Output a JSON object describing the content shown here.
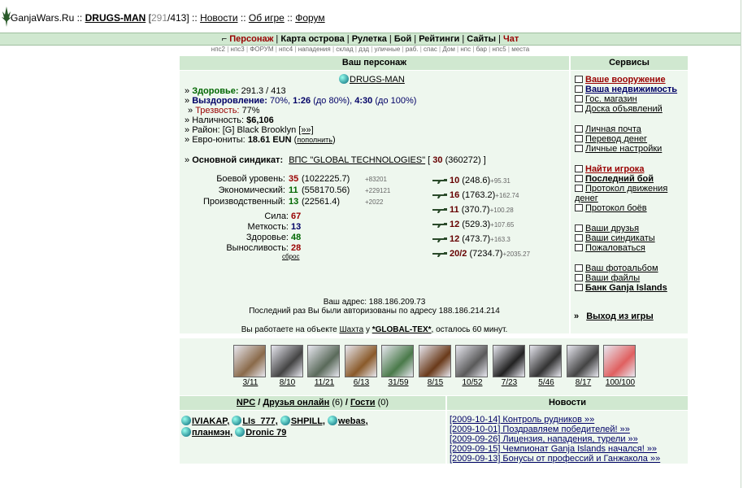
{
  "header": {
    "site": "GanjaWars.Ru",
    "sep1": "::",
    "nick": "DRUGS-MAN",
    "hp_current": "291",
    "hp_max": "/413]",
    "bracket_open": "[",
    "sep2": "::",
    "news_link": "Новости",
    "sep3": "::",
    "about_link": "Об игре",
    "sep4": "::",
    "forum_link": "Форум"
  },
  "topnav": [
    {
      "label": "Персонаж",
      "red": true
    },
    {
      "label": "Карта острова",
      "red": false
    },
    {
      "label": "Рулетка",
      "red": false
    },
    {
      "label": "Бой",
      "red": false
    },
    {
      "label": "Рейтинги",
      "red": false
    },
    {
      "label": "Сайты",
      "red": false
    },
    {
      "label": "Чат",
      "red": true
    }
  ],
  "subnav": [
    "нпс2",
    "нпс3",
    "ФОРУМ",
    "нпс4",
    "нападения",
    "склад",
    "дзд",
    "уличные",
    "раб.",
    "спас",
    "Дом",
    "нпс",
    "бар",
    "нпс5",
    "места"
  ],
  "character": {
    "header": "Ваш персонаж",
    "nick": "DRUGS-MAN",
    "health_label": "Здоровье:",
    "health_value": "291.3 / 413",
    "recovery_label": "Выздоровление:",
    "recovery_pct": "70%,",
    "recovery_t1": "1:26",
    "recovery_t1_note": "(до 80%),",
    "recovery_t2": "4:30",
    "recovery_t2_note": "(до 100%)",
    "sobriety_label": "Трезвость:",
    "sobriety_value": "77%",
    "cash_label": "Наличность:",
    "cash_value": "$6,106",
    "district_label": "Район:",
    "district_value": "[G] Black Brooklyn",
    "district_link": "[»»]",
    "euro_label": "Евро-юниты:",
    "euro_value": "18.61 EUN",
    "euro_link": "пополнить",
    "syndicate_label": "Основной синдикат:",
    "syndicate_name": "ВПС \"GLOBAL TECHNOLOGIES\"",
    "syndicate_level": "30",
    "syndicate_exp": "(360272)",
    "levels": [
      {
        "label": "Боевой уровень:",
        "value": "35",
        "exp": "(1022225.7)",
        "plus": "+83201"
      },
      {
        "label": "Экономический:",
        "value": "11",
        "exp": "(558170.56)",
        "plus": "+229121"
      },
      {
        "label": "Производственный:",
        "value": "13",
        "exp": "(22561.4)",
        "plus": "+2022"
      }
    ],
    "stats": [
      {
        "label": "Сила:",
        "value": "67"
      },
      {
        "label": "Меткость:",
        "value": "13"
      },
      {
        "label": "Здоровье:",
        "value": "48"
      },
      {
        "label": "Выносливость:",
        "value": "28"
      }
    ],
    "reset_link": "сброс",
    "weapons": [
      {
        "icon": "pistol-icon",
        "level": "10",
        "exp": "(248.6)",
        "plus": "+95.31"
      },
      {
        "icon": "shotgun-icon",
        "level": "16",
        "exp": "(1763.2)",
        "plus": "+162.74"
      },
      {
        "icon": "smg-icon",
        "level": "11",
        "exp": "(370.7)",
        "plus": "+100.28"
      },
      {
        "icon": "machinegun-icon",
        "level": "12",
        "exp": "(529.3)",
        "plus": "+107.65"
      },
      {
        "icon": "rifle-icon",
        "level": "12",
        "exp": "(473.7)",
        "plus": "+163.3"
      },
      {
        "icon": "grenade-launcher-icon",
        "level": "20/2",
        "exp": "(7234.7)",
        "plus": "+2035.27"
      }
    ],
    "address_line": "Ваш адрес: 188.186.209.73",
    "last_login_line": "Последний раз Вы были авторизованы по адресу 188.186.214.214",
    "work_prefix": "Вы работаете на объекте",
    "work_object": "Шахта",
    "work_at": "у",
    "work_owner": "*GLOBAL-TEX*",
    "work_suffix": ", осталось 60 минут."
  },
  "services": {
    "header": "Сервисы",
    "groups": [
      [
        {
          "label": "Ваше вооружение",
          "style": "red",
          "icon": "weapon-icon"
        },
        {
          "label": "Ваша недвижимость",
          "style": "navy-bold",
          "icon": "house-icon"
        },
        {
          "label": "Гос. магазин",
          "style": "normal",
          "icon": "shop-icon"
        },
        {
          "label": "Доска объявлений",
          "style": "normal",
          "icon": "board-icon"
        }
      ],
      [
        {
          "label": "Личная почта",
          "style": "normal",
          "icon": "mail-icon"
        },
        {
          "label": "Перевод денег",
          "style": "normal",
          "icon": "money-transfer-icon"
        },
        {
          "label": "Личные настройки",
          "style": "normal",
          "icon": "settings-icon"
        }
      ],
      [
        {
          "label": "Найти игрока",
          "style": "red",
          "icon": "search-icon"
        },
        {
          "label": "Последний бой",
          "style": "bold",
          "icon": "battle-icon"
        },
        {
          "label": "Протокол движения денег",
          "style": "normal",
          "icon": "log-icon"
        },
        {
          "label": "Протокол боёв",
          "style": "normal",
          "icon": "battle-log-icon"
        }
      ],
      [
        {
          "label": "Ваши друзья",
          "style": "normal",
          "icon": "friends-icon"
        },
        {
          "label": "Ваши синдикаты",
          "style": "normal",
          "icon": "syndicate-icon"
        },
        {
          "label": "Пожаловаться",
          "style": "normal",
          "icon": "complaint-icon"
        }
      ],
      [
        {
          "label": "Ваш фотоальбом",
          "style": "normal",
          "icon": "photo-icon"
        },
        {
          "label": "Ваши файлы",
          "style": "normal",
          "icon": "files-icon"
        },
        {
          "label": "Банк Ganja Islands",
          "style": "bold",
          "icon": "dollar-icon"
        }
      ]
    ],
    "exit_prefix": "»",
    "exit_label": "Выход из игры"
  },
  "items": [
    {
      "name": "assault-rifle",
      "count": "3/11",
      "color": "#8a6a4a"
    },
    {
      "name": "belt",
      "count": "8/10",
      "color": "#444444"
    },
    {
      "name": "helmet",
      "count": "11/21",
      "color": "#5a6a5a"
    },
    {
      "name": "vest",
      "count": "6/13",
      "color": "#8a5a2a"
    },
    {
      "name": "camo-suit",
      "count": "31/59",
      "color": "#4a7a4a"
    },
    {
      "name": "boots",
      "count": "8/15",
      "color": "#6a3a1a"
    },
    {
      "name": "helicopter",
      "count": "10/52",
      "color": "#5a5a5a"
    },
    {
      "name": "phone",
      "count": "7/23",
      "color": "#222222"
    },
    {
      "name": "shovel",
      "count": "5/46",
      "color": "#333333"
    },
    {
      "name": "binoculars",
      "count": "8/17",
      "color": "#444444"
    },
    {
      "name": "medkit",
      "count": "100/100",
      "color": "#e06060"
    }
  ],
  "online": {
    "npc": "NPC",
    "slash1": "/",
    "friends": "Друзья онлайн",
    "friends_count": "(6)",
    "slash2": "/",
    "guests": "Гости",
    "guests_count": "(0)",
    "users_line1": [
      "IVIAKAP,",
      "LIs_777,",
      "SHPILL,",
      "webas,"
    ],
    "users_line2": [
      "планмэн,",
      "Dronic 79"
    ]
  },
  "news": {
    "header": "Новости",
    "items": [
      "[2009-10-14] Контроль рудников »»",
      "[2009-10-01] Поздравляем победителей! »»",
      "[2009-09-26] Лицензия, нападения, турели »»",
      "[2009-09-15] Чемпионат Ganja Islands начался! »»",
      "[2009-09-13] Бонусы от профессий и Ганжакола »»"
    ]
  },
  "colors": {
    "panel": "#eef7ee",
    "header": "#d0e8d0",
    "red": "#990000",
    "navy": "#000066",
    "green": "#006600"
  }
}
